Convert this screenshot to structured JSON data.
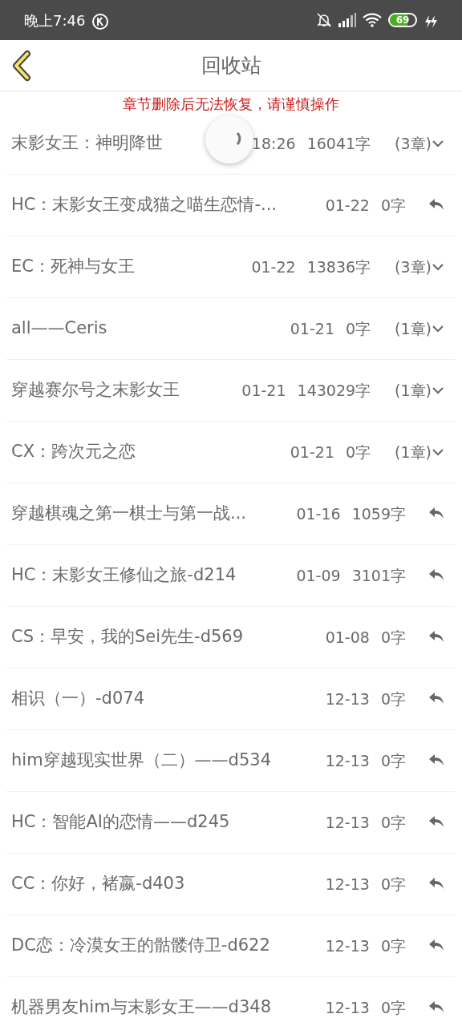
{
  "status_bar": {
    "time": "晚上7:46",
    "battery": "69"
  },
  "header": {
    "title": "回收站"
  },
  "notice": "章节删除后无法恢复，请谨慎操作",
  "loading": true,
  "items": [
    {
      "kind": "book",
      "title": "末影女王：神明降世",
      "date": "18:26",
      "words": "16041字",
      "chapters": "(3章)"
    },
    {
      "kind": "chapter",
      "title": "HC：末影女王变成猫之喵生恋情-...",
      "date": "01-22",
      "words": "0字"
    },
    {
      "kind": "book",
      "title": "EC：死神与女王",
      "date": "01-22",
      "words": "13836字",
      "chapters": "(3章)"
    },
    {
      "kind": "book",
      "title": "all——Ceris",
      "date": "01-21",
      "words": "0字",
      "chapters": "(1章)"
    },
    {
      "kind": "book",
      "title": "穿越赛尔号之末影女王",
      "date": "01-21",
      "words": "143029字",
      "chapters": "(1章)"
    },
    {
      "kind": "book",
      "title": "CX：跨次元之恋",
      "date": "01-21",
      "words": "0字",
      "chapters": "(1章)"
    },
    {
      "kind": "chapter",
      "title": "穿越棋魂之第一棋士与第一战...",
      "date": "01-16",
      "words": "1059字"
    },
    {
      "kind": "chapter",
      "title": "HC：末影女王修仙之旅-d214",
      "date": "01-09",
      "words": "3101字"
    },
    {
      "kind": "chapter",
      "title": "CS：早安，我的Sei先生-d569",
      "date": "01-08",
      "words": "0字"
    },
    {
      "kind": "chapter",
      "title": "相识（一）-d074",
      "date": "12-13",
      "words": "0字"
    },
    {
      "kind": "chapter",
      "title": "him穿越现实世界（二）——d534",
      "date": "12-13",
      "words": "0字"
    },
    {
      "kind": "chapter",
      "title": "HC：智能AI的恋情——d245",
      "date": "12-13",
      "words": "0字"
    },
    {
      "kind": "chapter",
      "title": "CC：你好，褚嬴-d403",
      "date": "12-13",
      "words": "0字"
    },
    {
      "kind": "chapter",
      "title": "DC恋：冷漠女王的骷髅侍卫-d622",
      "date": "12-13",
      "words": "0字"
    },
    {
      "kind": "chapter",
      "title": "机器男友him与末影女王——d348",
      "date": "12-13",
      "words": "0字"
    }
  ]
}
